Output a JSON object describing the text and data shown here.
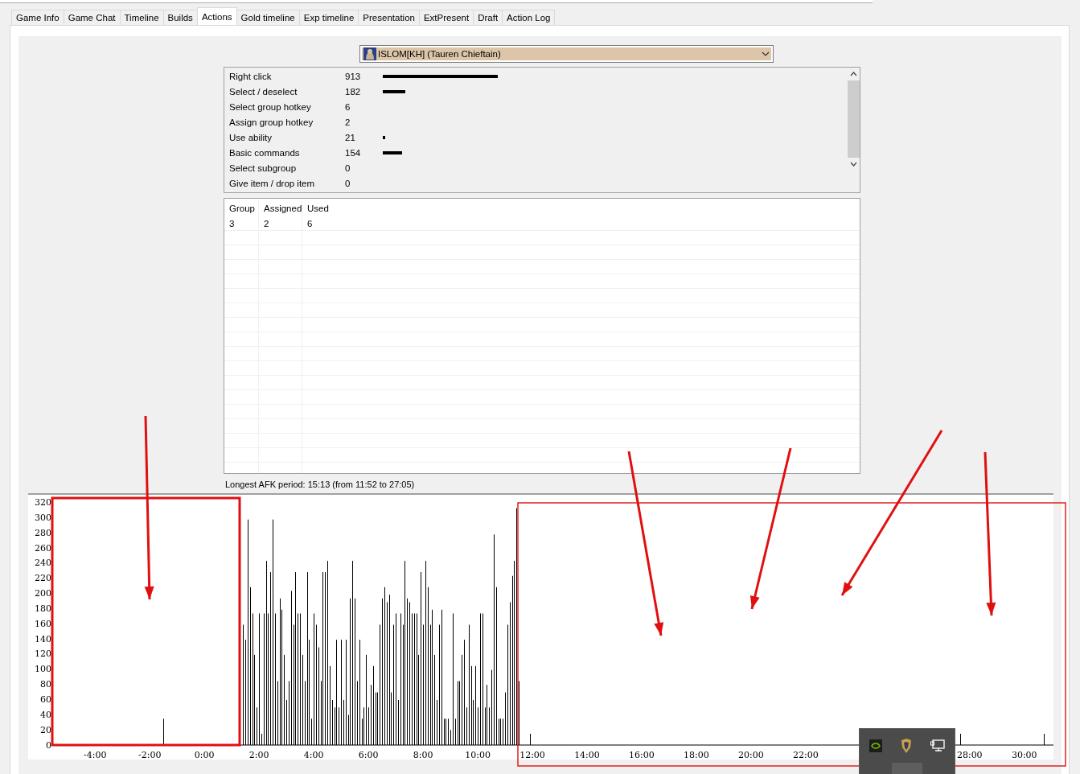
{
  "tabs": [
    {
      "label": "Game Info",
      "selected": false
    },
    {
      "label": "Game Chat",
      "selected": false
    },
    {
      "label": "Timeline",
      "selected": false
    },
    {
      "label": "Builds",
      "selected": false
    },
    {
      "label": "Actions",
      "selected": true
    },
    {
      "label": "Gold timeline",
      "selected": false
    },
    {
      "label": "Exp timeline",
      "selected": false
    },
    {
      "label": "Presentation",
      "selected": false
    },
    {
      "label": "ExtPresent",
      "selected": false
    },
    {
      "label": "Draft",
      "selected": false
    },
    {
      "label": "Action Log",
      "selected": false
    }
  ],
  "player_select": {
    "value": "ISLOM[KH] (Tauren Chieftain)"
  },
  "actions": [
    {
      "name": "Right click",
      "count": "913"
    },
    {
      "name": "Select / deselect",
      "count": "182"
    },
    {
      "name": "Select group hotkey",
      "count": "6"
    },
    {
      "name": "Assign group hotkey",
      "count": "2"
    },
    {
      "name": "Use ability",
      "count": "21"
    },
    {
      "name": "Basic commands",
      "count": "154"
    },
    {
      "name": "Select subgroup",
      "count": "0"
    },
    {
      "name": "Give item / drop item",
      "count": "0"
    }
  ],
  "groups_table": {
    "columns": [
      "Group",
      "Assigned",
      "Used"
    ],
    "rows": [
      [
        "3",
        "2",
        "6"
      ]
    ]
  },
  "afk_label": "Longest AFK period: 15:13 (from 11:52 to 27:05)",
  "chart_data": {
    "type": "bar",
    "x": [
      -90,
      85,
      90,
      95,
      100,
      105,
      110,
      115,
      120,
      125,
      130,
      135,
      140,
      145,
      150,
      155,
      160,
      165,
      170,
      175,
      180,
      185,
      190,
      195,
      200,
      205,
      210,
      215,
      220,
      225,
      230,
      235,
      240,
      245,
      250,
      255,
      260,
      265,
      270,
      275,
      280,
      285,
      290,
      295,
      300,
      305,
      310,
      315,
      320,
      325,
      330,
      335,
      340,
      345,
      350,
      355,
      360,
      365,
      370,
      375,
      380,
      385,
      390,
      395,
      400,
      405,
      410,
      415,
      420,
      425,
      430,
      435,
      440,
      445,
      450,
      455,
      460,
      465,
      470,
      475,
      480,
      485,
      490,
      495,
      500,
      505,
      510,
      515,
      520,
      525,
      530,
      535,
      540,
      545,
      550,
      555,
      560,
      565,
      570,
      575,
      580,
      585,
      590,
      595,
      600,
      605,
      610,
      615,
      620,
      625,
      630,
      635,
      640,
      645,
      650,
      655,
      660,
      665,
      670,
      675,
      680,
      685,
      690,
      715,
      1660,
      1842
    ],
    "series": [
      {
        "color": "#000000",
        "values": [
          35,
          160,
          140,
          300,
          210,
          175,
          120,
          50,
          175,
          15,
          175,
          245,
          175,
          230,
          300,
          175,
          85,
          195,
          180,
          120,
          60,
          85,
          205,
          160,
          230,
          175,
          175,
          120,
          85,
          230,
          140,
          35,
          175,
          160,
          130,
          85,
          230,
          230,
          245,
          105,
          60,
          50,
          140,
          50,
          140,
          60,
          140,
          40,
          195,
          245,
          195,
          85,
          140,
          35,
          50,
          120,
          50,
          80,
          105,
          70,
          70,
          160,
          195,
          210,
          190,
          200,
          70,
          160,
          175,
          60,
          175,
          160,
          245,
          195,
          190,
          175,
          175,
          175,
          120,
          230,
          160,
          245,
          210,
          160,
          180,
          120,
          60,
          160,
          180,
          35,
          35,
          35,
          20,
          175,
          35,
          85,
          85,
          120,
          140,
          50,
          160,
          105,
          60,
          105,
          50,
          175,
          175,
          50,
          80,
          50,
          100,
          280,
          210,
          35,
          35,
          35,
          70,
          160,
          190,
          225,
          245,
          315,
          85,
          15,
          15,
          15
        ]
      }
    ],
    "xlim": [
      -334,
      1864
    ],
    "ylim": [
      0,
      320
    ],
    "xticks": [
      {
        "value": -240,
        "label": "-4:00"
      },
      {
        "value": -120,
        "label": "-2:00"
      },
      {
        "value": 0,
        "label": "0:00"
      },
      {
        "value": 120,
        "label": "2:00"
      },
      {
        "value": 240,
        "label": "4:00"
      },
      {
        "value": 360,
        "label": "6:00"
      },
      {
        "value": 480,
        "label": "8:00"
      },
      {
        "value": 600,
        "label": "10:00"
      },
      {
        "value": 720,
        "label": "12:00"
      },
      {
        "value": 840,
        "label": "14:00"
      },
      {
        "value": 960,
        "label": "16:00"
      },
      {
        "value": 1080,
        "label": "18:00"
      },
      {
        "value": 1200,
        "label": "20:00"
      },
      {
        "value": 1320,
        "label": "22:00"
      },
      {
        "value": 1680,
        "label": "28:00"
      },
      {
        "value": 1800,
        "label": "30:00"
      }
    ],
    "yticks": [
      0,
      20,
      40,
      60,
      80,
      100,
      120,
      140,
      160,
      180,
      200,
      220,
      240,
      260,
      280,
      300,
      320
    ]
  }
}
